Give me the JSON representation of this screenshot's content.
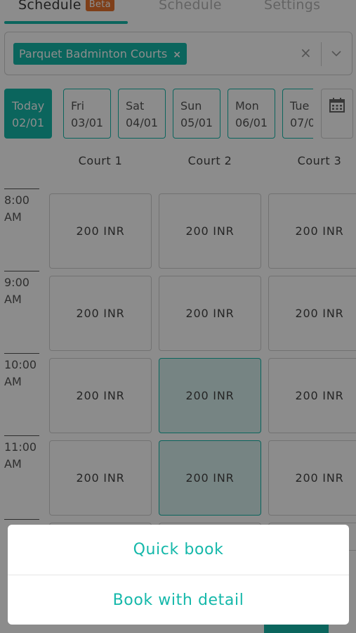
{
  "tabs": [
    {
      "label": "Schedule",
      "badge": "Beta"
    },
    {
      "label": "Schedule"
    },
    {
      "label": "Settings"
    }
  ],
  "venue_select": {
    "chip": "Parquet Badminton Courts",
    "chip_remove": "×",
    "clear": "×"
  },
  "dates": [
    {
      "day": "Today",
      "date": "02/01"
    },
    {
      "day": "Fri",
      "date": "03/01"
    },
    {
      "day": "Sat",
      "date": "04/01"
    },
    {
      "day": "Sun",
      "date": "05/01"
    },
    {
      "day": "Mon",
      "date": "06/01"
    },
    {
      "day": "Tue",
      "date": "07/0"
    }
  ],
  "courts": [
    "Court 1",
    "Court 2",
    "Court 3"
  ],
  "rows": [
    {
      "time": "8:00",
      "ampm": "AM",
      "prices": [
        "200 INR",
        "200 INR",
        "200 INR"
      ]
    },
    {
      "time": "9:00",
      "ampm": "AM",
      "prices": [
        "200 INR",
        "200 INR",
        "200 INR"
      ]
    },
    {
      "time": "10:00",
      "ampm": "AM",
      "prices": [
        "200 INR",
        "200 INR",
        "200 INR"
      ]
    },
    {
      "time": "11:00",
      "ampm": "AM",
      "prices": [
        "200 INR",
        "200 INR",
        "200 INR"
      ]
    }
  ],
  "action_sheet": {
    "quick_book": "Quick book",
    "book_with_detail": "Book with detail"
  },
  "colors": {
    "accent": "#15b8aa",
    "beta_badge": "#e8742e",
    "selected_slot_bg": "#d8f1ef"
  },
  "icons": [
    "close-icon",
    "chevron-down-icon",
    "calendar-icon"
  ]
}
